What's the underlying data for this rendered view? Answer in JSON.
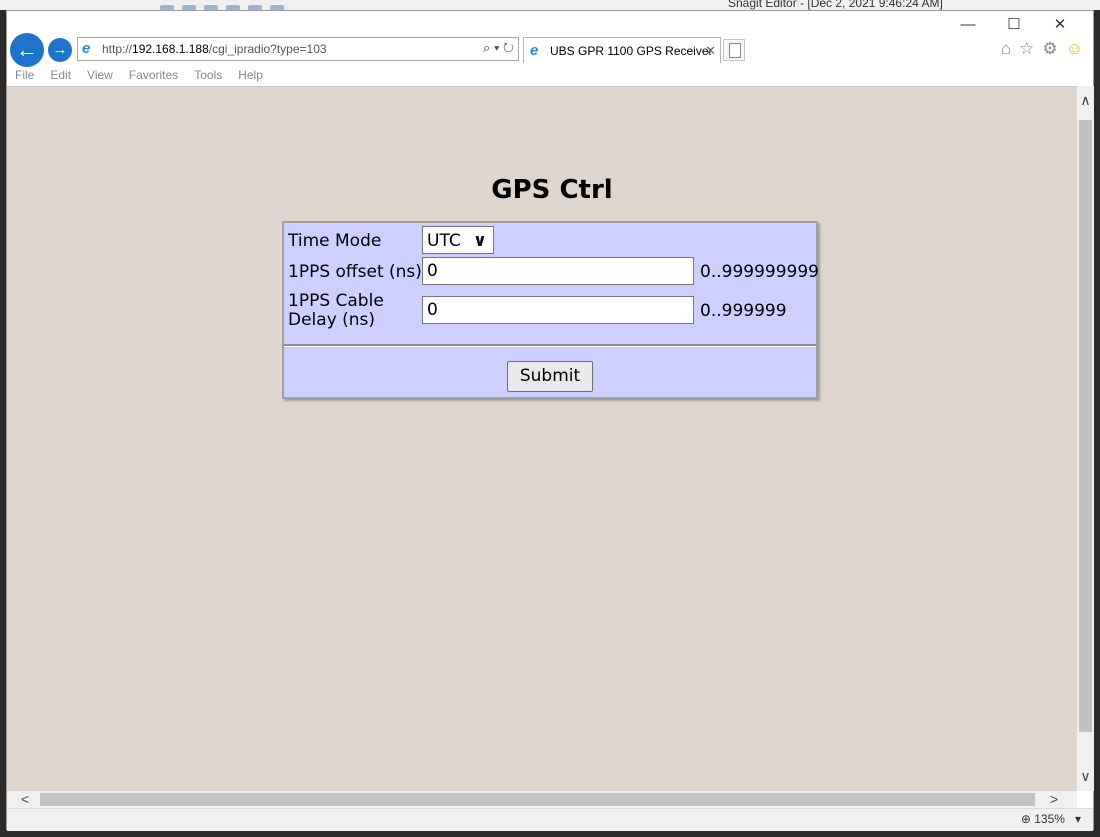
{
  "background": {
    "window_title": "Snagit Editor - [Dec 2, 2021 9:46:24 AM]"
  },
  "window_controls": {
    "minimize": "—",
    "maximize": "☐",
    "close": "✕"
  },
  "browser": {
    "address_prefix": "http://",
    "address_host": "192.168.1.188",
    "address_path": "/cgi_ipradio?type=103",
    "tab_title": "UBS GPR 1100 GPS Receiver",
    "menu": [
      "File",
      "Edit",
      "View",
      "Favorites",
      "Tools",
      "Help"
    ],
    "zoom": "135%"
  },
  "page": {
    "title": "GPS Ctrl",
    "fields": [
      {
        "label": "Time Mode",
        "value": "UTC",
        "type": "select"
      },
      {
        "label": "1PPS offset (ns)",
        "value": "0",
        "range": "0..999999999"
      },
      {
        "label_line1": "1PPS Cable",
        "label_line2": "Delay (ns)",
        "value": "0",
        "range": "0..999999"
      }
    ],
    "submit_label": "Submit"
  },
  "colors": {
    "page_bg": "#dfd5cf",
    "form_bg": "#cccfff",
    "ie_blue": "#1e73cc"
  }
}
